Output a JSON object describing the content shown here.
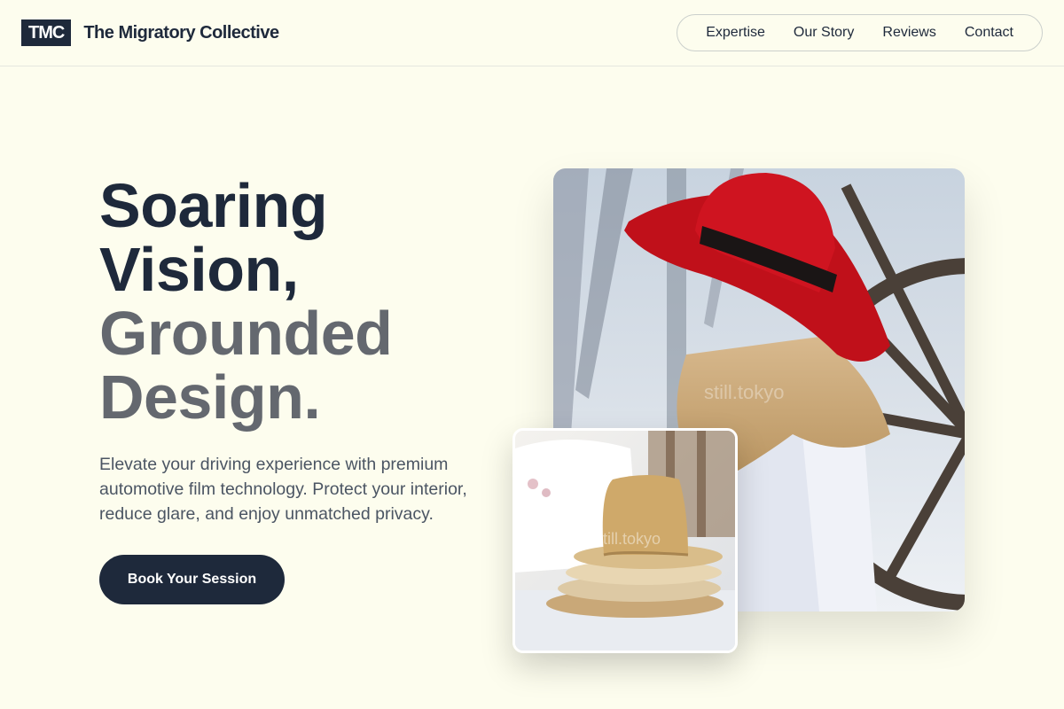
{
  "brand": {
    "badge": "TMC",
    "name": "The Migratory Collective"
  },
  "nav": {
    "items": [
      "Expertise",
      "Our Story",
      "Reviews",
      "Contact"
    ]
  },
  "hero": {
    "title_line1": "Soaring",
    "title_line2": "Vision,",
    "title_line3": "Grounded",
    "title_line4": "Design.",
    "description": "Elevate your driving experience with premium automotive film technology. Protect your interior, reduce glare, and enjoy unmatched privacy.",
    "cta_label": "Book Your Session"
  },
  "images": {
    "main_watermark": "still.tokyo",
    "small_watermark": "still.tokyo"
  },
  "colors": {
    "background": "#fdfdee",
    "primary": "#1e293b",
    "muted_heading": "#64686f",
    "body_text": "#4b5563"
  }
}
